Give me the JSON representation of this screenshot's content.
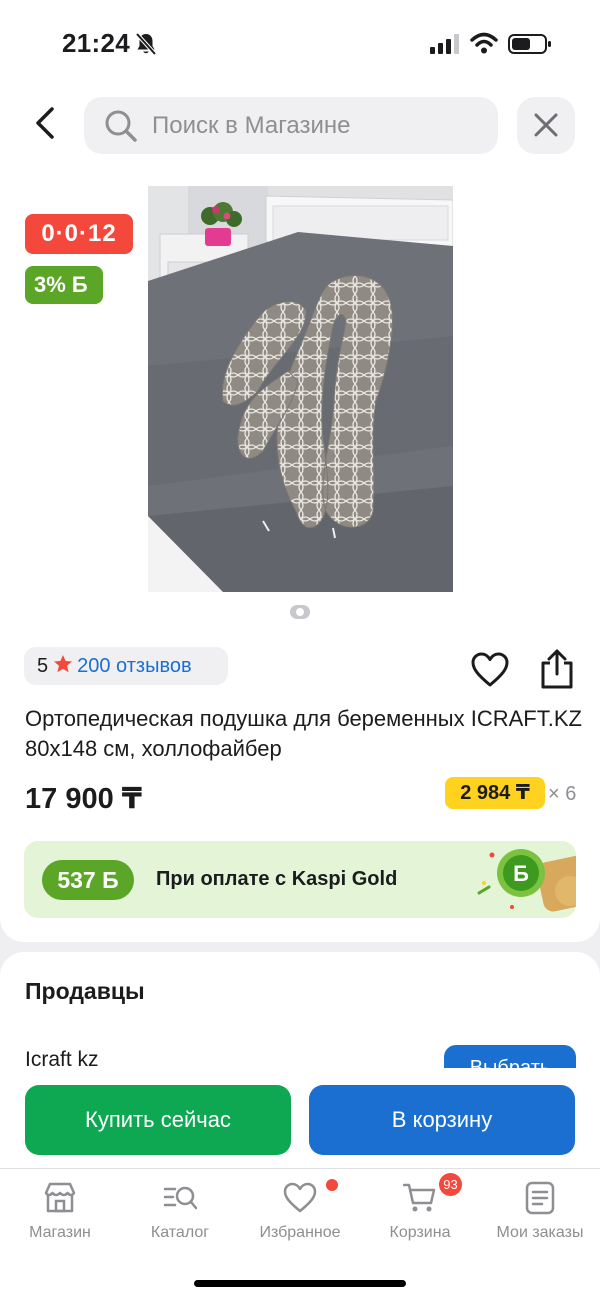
{
  "status_bar": {
    "time": "21:24"
  },
  "search": {
    "placeholder": "Поиск в Магазине"
  },
  "badges": {
    "timer": "0·0·12",
    "bonus": "3% Б"
  },
  "rating": {
    "value": "5",
    "reviews": "200 отзывов"
  },
  "product": {
    "title": "Ортопедическая подушка для беременных ICRAFT.KZ 80x148 см, холлофайбер",
    "price": "17 900 ₸",
    "installment": {
      "amount": "2 984 ₸",
      "months": "× 6"
    }
  },
  "kaspi_banner": {
    "bonus": "537 Б",
    "text": "При оплате с Kaspi Gold"
  },
  "sellers": {
    "title": "Продавцы",
    "seller_name": "Icraft kz",
    "choose_label": "Выбрать"
  },
  "actions": {
    "buy_now": "Купить сейчас",
    "add_to_cart": "В корзину"
  },
  "tabs": [
    {
      "label": "Магазин",
      "icon": "shop-icon"
    },
    {
      "label": "Каталог",
      "icon": "catalog-icon"
    },
    {
      "label": "Избранное",
      "icon": "heart-icon"
    },
    {
      "label": "Корзина",
      "icon": "cart-icon",
      "badge": "93"
    },
    {
      "label": "Мои заказы",
      "icon": "orders-icon"
    }
  ],
  "colors": {
    "accent_blue": "#1a6fd1",
    "buy_green": "#0ea853",
    "bonus_green": "#5ba527",
    "alert_red": "#f3483b",
    "installment_yellow": "#ffd21f"
  }
}
